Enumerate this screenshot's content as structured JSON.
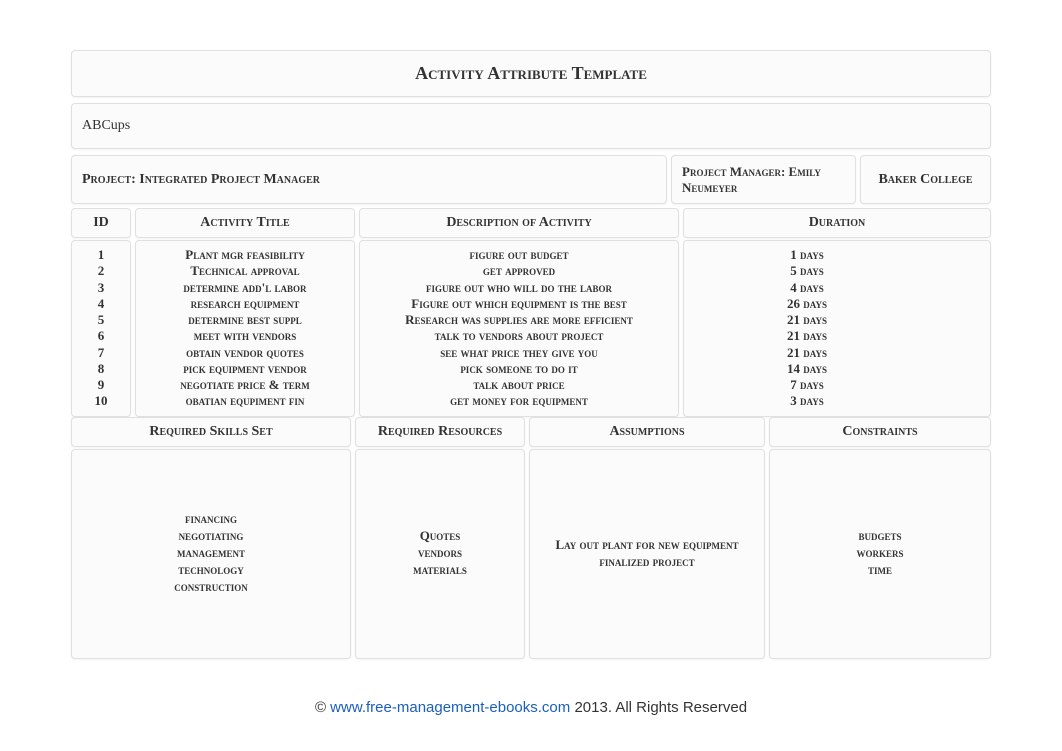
{
  "title": "Activity Attribute Template",
  "subtitle": "ABCups",
  "info": {
    "project_label": "Project: Integrated Project Manager",
    "manager_label": "Project Manager: Emily Neumeyer",
    "college": "Baker College"
  },
  "headers": {
    "id": "ID",
    "title": "Activity Title",
    "desc": "Description of Activity",
    "duration": "Duration"
  },
  "activities": [
    {
      "id": "1",
      "title": "Plant mgr feasibility",
      "desc": "figure out budget",
      "duration": "1 days"
    },
    {
      "id": "2",
      "title": "Technical approval",
      "desc": "get approved",
      "duration": "5 days"
    },
    {
      "id": "3",
      "title": "determine add'l labor",
      "desc": "figure out who will do the labor",
      "duration": "4 days"
    },
    {
      "id": "4",
      "title": "research equipment",
      "desc": "Figure out which equipment is the best",
      "duration": "26 days"
    },
    {
      "id": "5",
      "title": "determine best suppl",
      "desc": "Research was supplies are more efficient",
      "duration": "21 days"
    },
    {
      "id": "6",
      "title": "meet with vendors",
      "desc": "talk to vendors about project",
      "duration": "21 days"
    },
    {
      "id": "7",
      "title": "obtain vendor quotes",
      "desc": "see what price they give you",
      "duration": "21 days"
    },
    {
      "id": "8",
      "title": "pick equipment vendor",
      "desc": "pick someone to do it",
      "duration": "14 days"
    },
    {
      "id": "9",
      "title": "negotiate price & term",
      "desc": "talk about price",
      "duration": "7 days"
    },
    {
      "id": "10",
      "title": "obatian equpiment fin",
      "desc": "get money for equipment",
      "duration": "3 days"
    }
  ],
  "bottom_headers": {
    "skills": "Required Skills Set",
    "resources": "Required Resources",
    "assumptions": "Assumptions",
    "constraints": "Constraints"
  },
  "skills": [
    "financing",
    "negotiating",
    "management",
    "technology",
    "construction"
  ],
  "resources": [
    "Quotes",
    "vendors",
    "materials"
  ],
  "assumptions": [
    "Lay out plant for new equipment",
    "finalized project"
  ],
  "constraints": [
    "budgets",
    "workers",
    "time"
  ],
  "footer": {
    "copyright": "©",
    "link": "www.free-management-ebooks.com",
    "rest": " 2013. All Rights Reserved"
  }
}
